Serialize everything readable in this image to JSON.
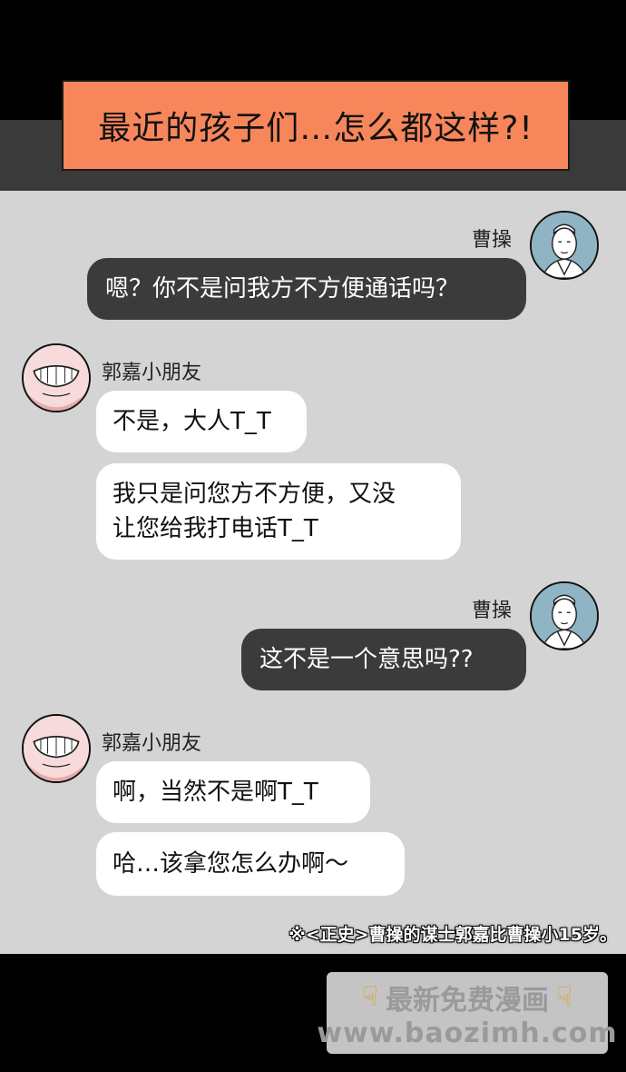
{
  "title": "最近的孩子们…怎么都这样?!",
  "messages": [
    {
      "sender": "曹操",
      "lines": [
        "嗯？你不是问我方不方便通话吗？"
      ]
    },
    {
      "sender": "郭嘉小朋友",
      "lines": [
        "不是，大人T_T",
        "我只是问您方不方便，又没\n让您给我打电话T_T"
      ]
    },
    {
      "sender": "曹操",
      "lines": [
        "这不是一个意思吗??"
      ]
    },
    {
      "sender": "郭嘉小朋友",
      "lines": [
        "啊，当然不是啊T_T",
        "哈…该拿您怎么办啊～"
      ]
    }
  ],
  "footnote": "※<正史>曹操的谋士郭嘉比曹操小15岁。",
  "watermark": {
    "line1": "最新免费漫画",
    "line2": "www.baozimh.com",
    "icon": "pointing-down-hand-icon"
  },
  "colors": {
    "title_bg": "#f7865b",
    "panel_bg": "#d4d4d4",
    "dark_bubble": "#3b3b3b",
    "light_bubble": "#ffffff"
  }
}
